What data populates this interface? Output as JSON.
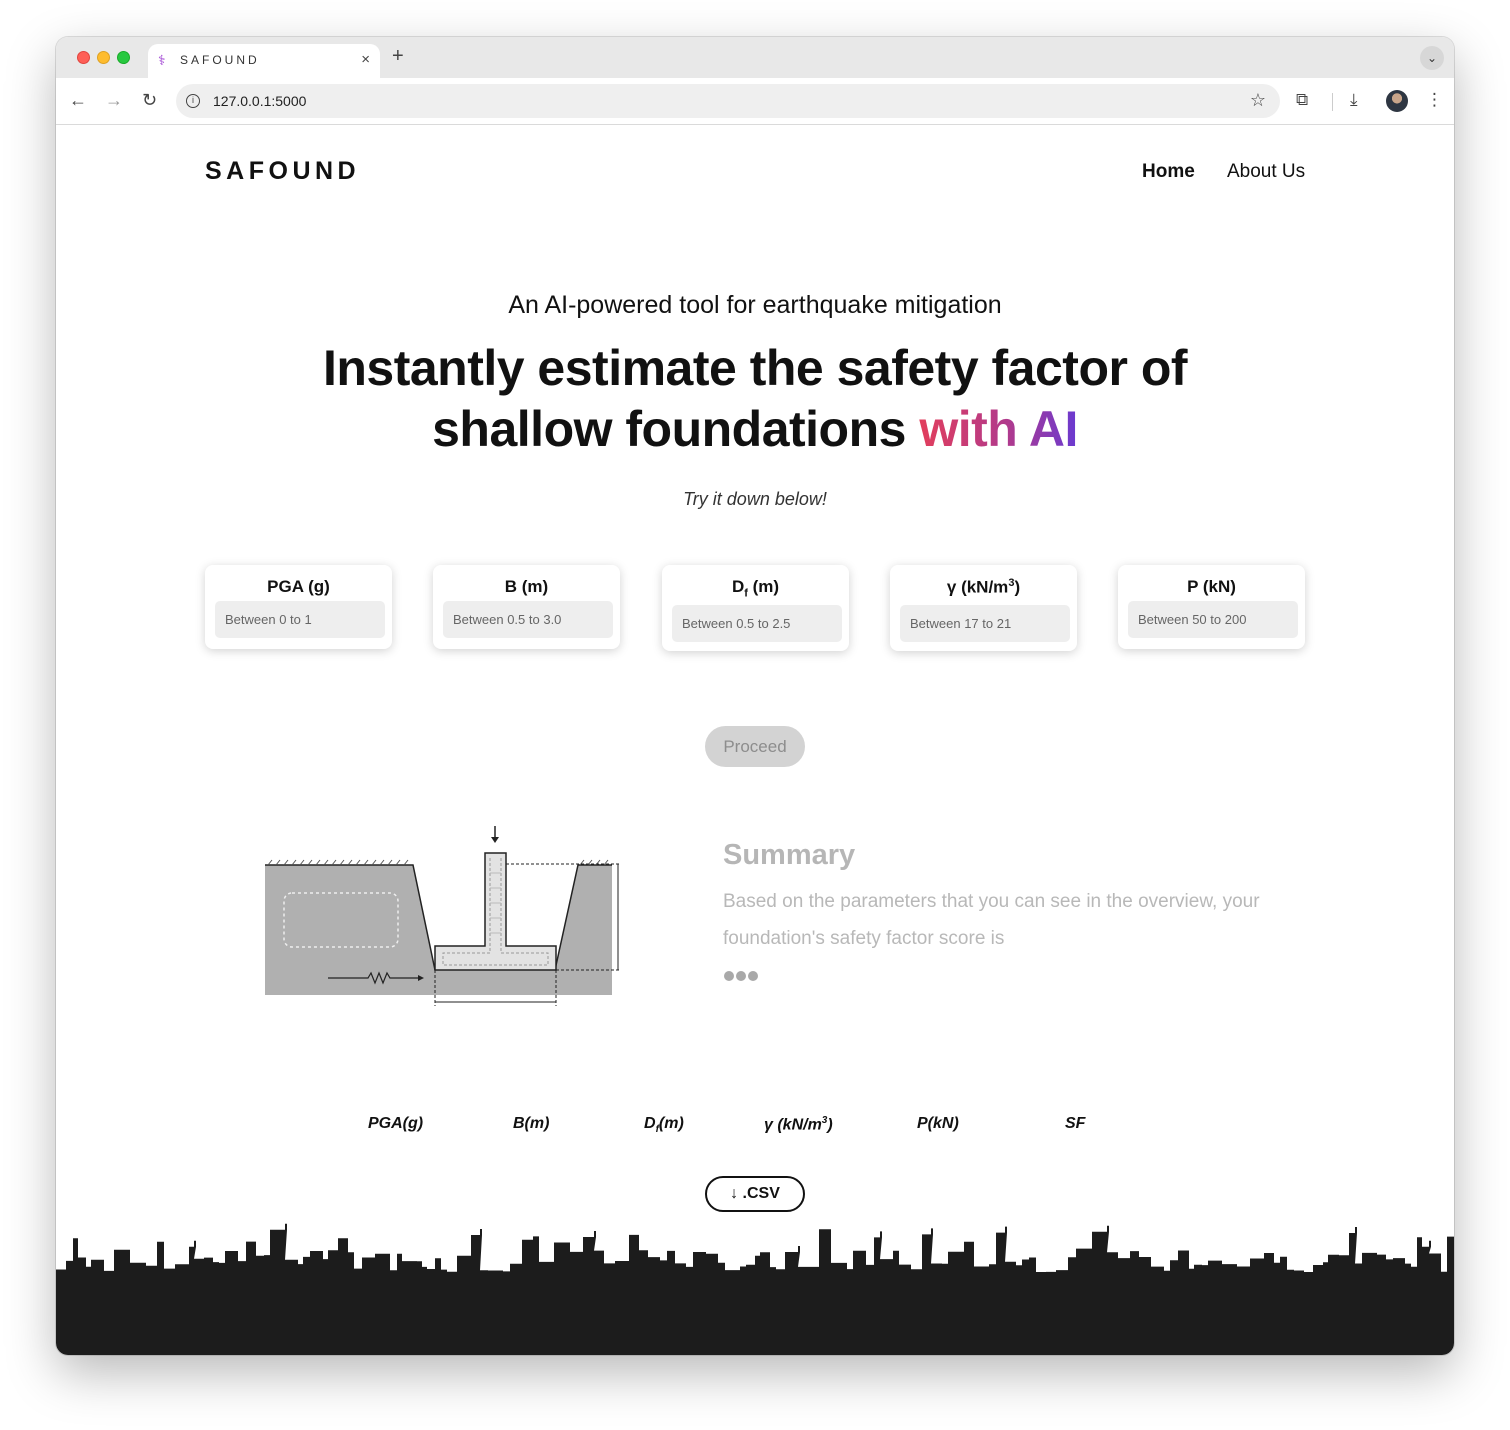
{
  "browser": {
    "tab_title": "SAFOUND",
    "tab_favicon": "⚕",
    "tab_close": "×",
    "new_tab": "+",
    "tab_menu": "⌄",
    "url": "127.0.0.1:5000",
    "icons": {
      "back": "←",
      "forward": "→",
      "reload": "↻",
      "info": "i",
      "star": "☆",
      "extensions": "⧉",
      "download": "⤓",
      "menu": "⋮"
    }
  },
  "header": {
    "brand": "SAFOUND",
    "nav": {
      "home": "Home",
      "about": "About Us"
    }
  },
  "hero": {
    "tagline": "An AI-powered tool for earthquake mitigation",
    "headline_line1": "Instantly estimate the safety factor of",
    "headline_line2_plain": "shallow foundations ",
    "headline_line2_accent": "with AI",
    "try_it": "Try it down below!"
  },
  "inputs": [
    {
      "label": "PGA (g)",
      "placeholder": "Between 0 to 1"
    },
    {
      "label": "B (m)",
      "placeholder": "Between 0.5 to 3.0"
    },
    {
      "label_main": "D",
      "label_sub": "f",
      "label_rest": " (m)",
      "placeholder": "Between 0.5 to 2.5"
    },
    {
      "label_main": "γ (kN/m",
      "label_sup": "3",
      "label_rest": ")",
      "placeholder": "Between 17 to 21"
    },
    {
      "label": "P (kN)",
      "placeholder": "Between 50 to 200"
    }
  ],
  "proceed_label": "Proceed",
  "summary": {
    "title": "Summary",
    "text": "Based on the parameters that you can see in the overview, your foundation's safety factor score is"
  },
  "table_headers": {
    "pga": "PGA(g)",
    "b": "B(m)",
    "df_main": "D",
    "df_sub": "f",
    "df_rest": "(m)",
    "gamma_main": "γ (kN/m",
    "gamma_sup": "3",
    "gamma_rest": ")",
    "p": "P(kN)",
    "sf": "SF"
  },
  "csv_button": {
    "icon": "↓",
    "label": ".CSV"
  },
  "colors": {
    "accent_start": "#e23e5c",
    "accent_end": "#6a3ad1",
    "skyline": "#1c1c1c",
    "summary_gray": "#b6b6b6"
  }
}
